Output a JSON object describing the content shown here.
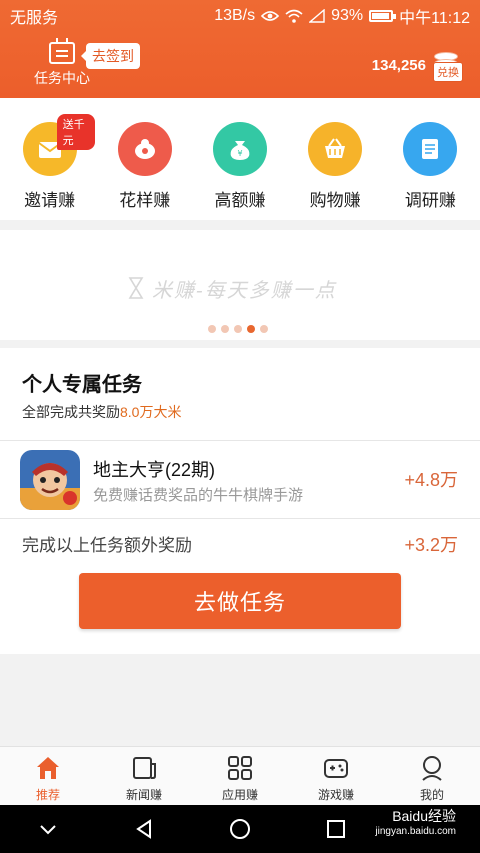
{
  "status_bar": {
    "carrier": "无服务",
    "speed": "13B/s",
    "battery": "93%",
    "time": "中午11:12"
  },
  "header": {
    "task_center_label": "任务中心",
    "signin_label": "去签到",
    "coin_count": "134,256",
    "exchange_label": "兑换"
  },
  "categories": [
    {
      "label": "邀请赚",
      "color": "#f6b829",
      "badge": "送千元",
      "icon": "envelope-icon"
    },
    {
      "label": "花样赚",
      "color": "#ee5b4b",
      "icon": "pattern-icon"
    },
    {
      "label": "高额赚",
      "color": "#33c8a4",
      "icon": "money-bag-icon"
    },
    {
      "label": "购物赚",
      "color": "#f6b32a",
      "icon": "basket-icon"
    },
    {
      "label": "调研赚",
      "color": "#37a7ef",
      "icon": "survey-icon"
    }
  ],
  "banner": {
    "slogan": "米赚-每天多赚一点",
    "dots_total": 5,
    "dot_active_index": 3
  },
  "personal_tasks": {
    "title": "个人专属任务",
    "subtitle_prefix": "全部完成共奖励",
    "subtitle_highlight": "8.0万大米",
    "tasks": [
      {
        "name": "地主大亨(22期)",
        "description": "免费赚话费奖品的牛牛棋牌手游",
        "reward": "+4.8万"
      }
    ],
    "extra_label": "完成以上任务额外奖励",
    "extra_reward": "+3.2万",
    "cta_label": "去做任务"
  },
  "tabbar": [
    {
      "label": "推荐",
      "active": true,
      "icon": "home-icon"
    },
    {
      "label": "新闻赚",
      "active": false,
      "icon": "news-icon"
    },
    {
      "label": "应用赚",
      "active": false,
      "icon": "apps-icon"
    },
    {
      "label": "游戏赚",
      "active": false,
      "icon": "gamepad-icon"
    },
    {
      "label": "我的",
      "active": false,
      "icon": "profile-icon"
    }
  ],
  "watermark": {
    "brand": "Baidu经验",
    "url": "jingyan.baidu.com"
  },
  "colors": {
    "accent": "#ec5f2c",
    "reward": "#d9663a",
    "highlight": "#e06a1e"
  }
}
